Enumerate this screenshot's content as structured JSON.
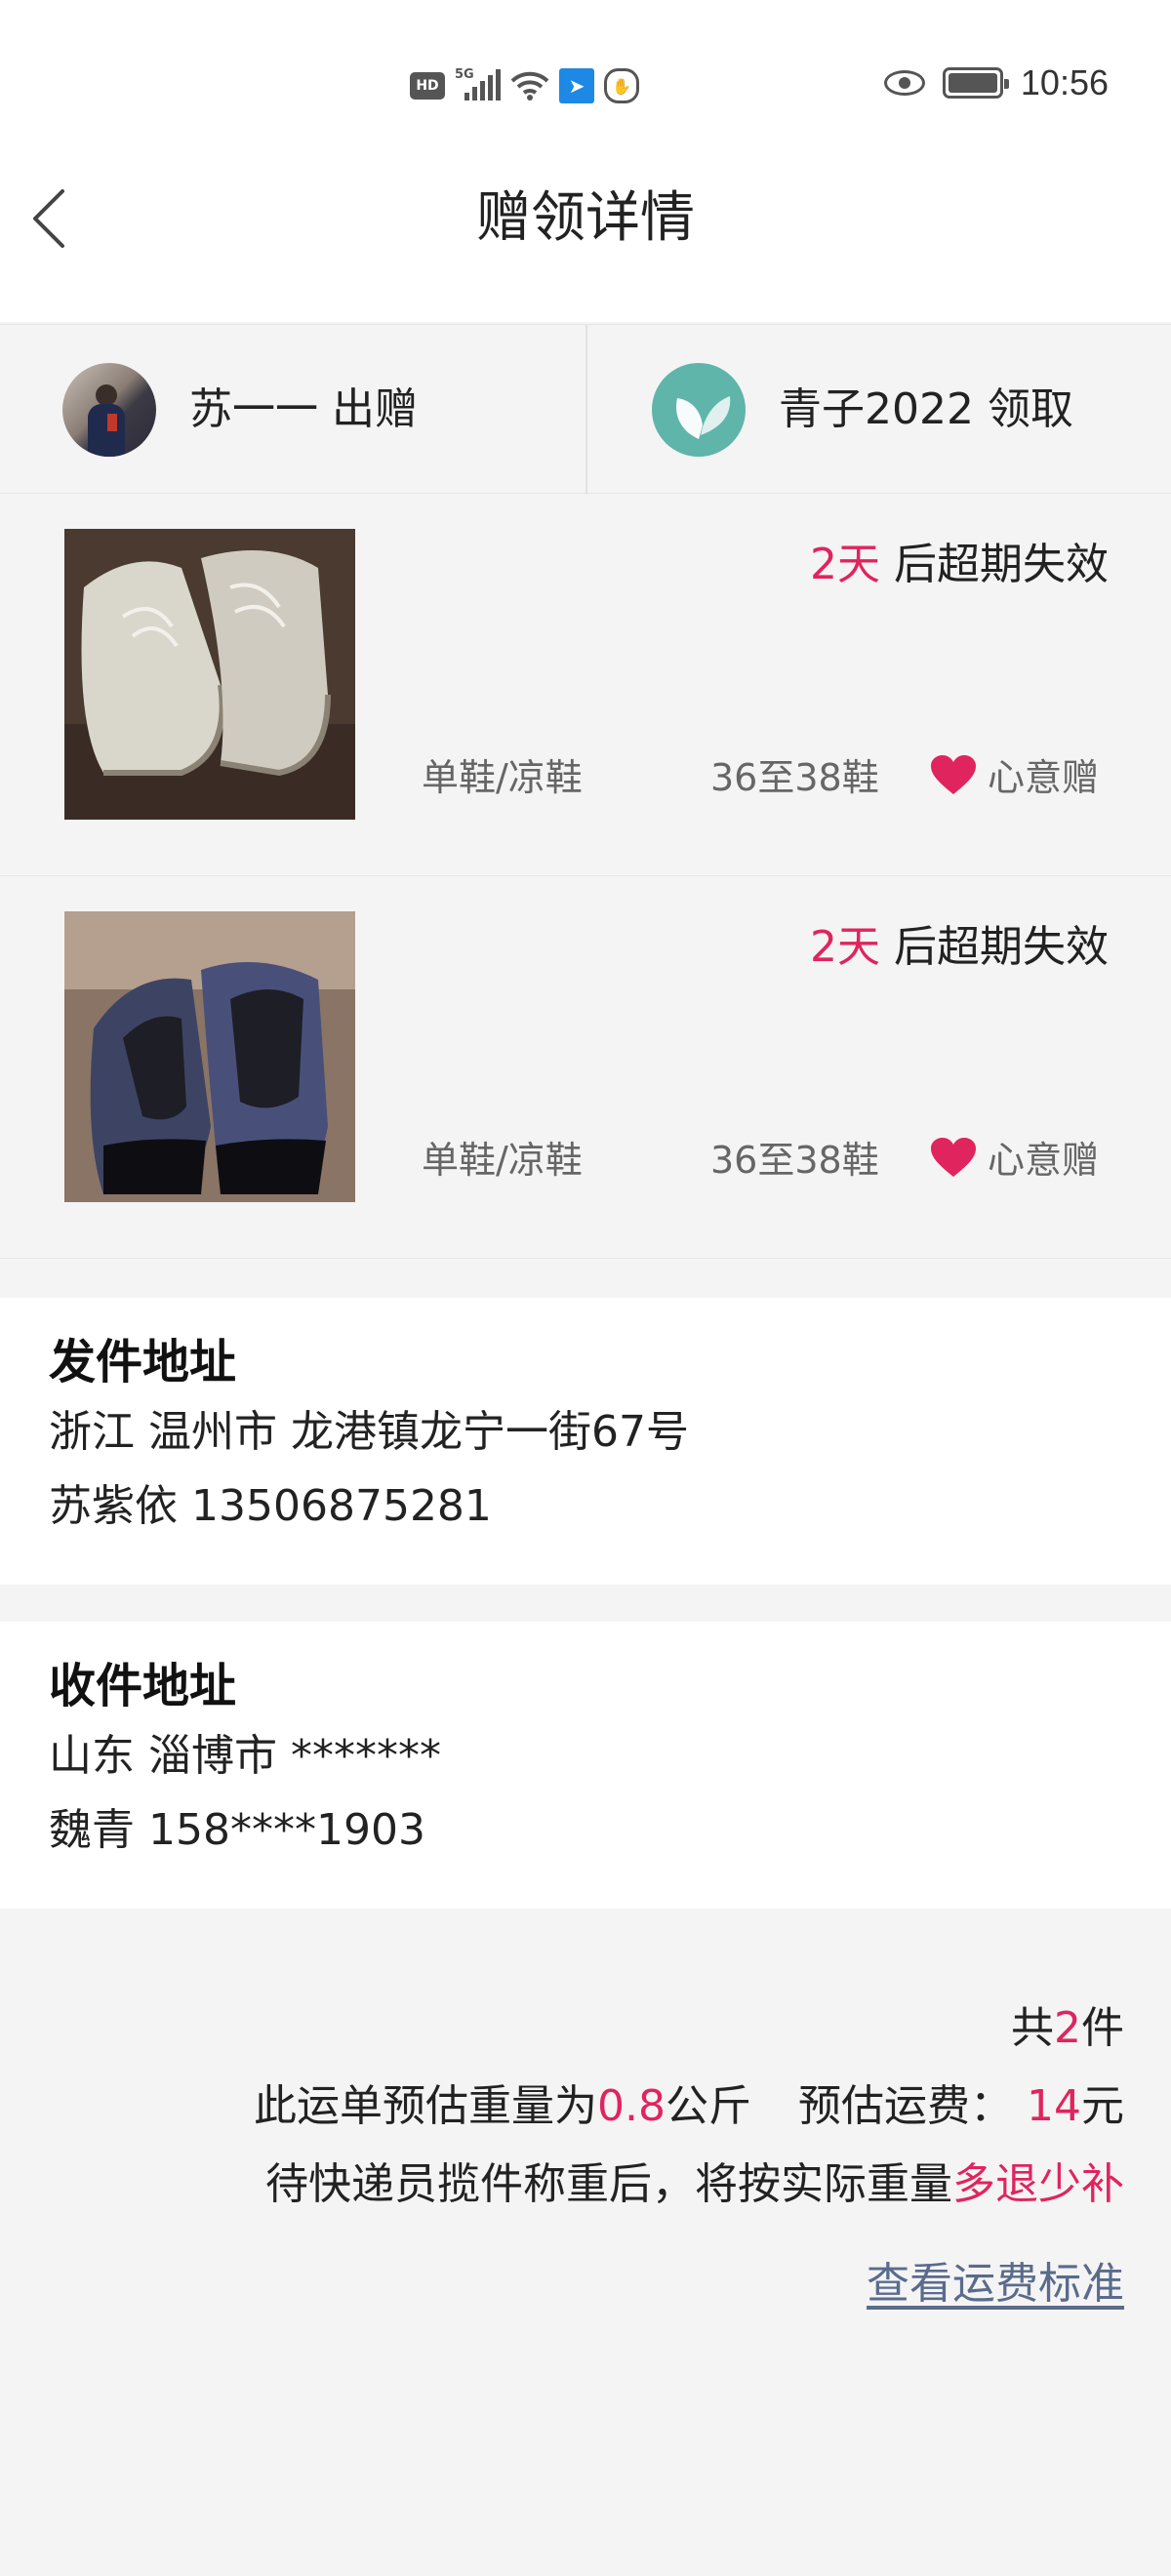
{
  "status_bar": {
    "hd_label": "HD",
    "net_label": "5G",
    "time": "10:56",
    "icons": [
      "hd-icon",
      "signal-icon",
      "wifi-icon",
      "app-notification-icon",
      "hand-icon",
      "eye-icon",
      "battery-icon"
    ]
  },
  "header": {
    "title": "赠领详情",
    "back_icon": "chevron-left-icon"
  },
  "parties": {
    "giver": {
      "name": "苏一一",
      "role": "出赠"
    },
    "receiver": {
      "name": "青子2022",
      "role": "领取"
    }
  },
  "items": [
    {
      "photo": "beige-lace-up-shoes",
      "expire_days": "2天",
      "expire_text": "后超期失效",
      "category": "单鞋/凉鞋",
      "size": "36至38鞋",
      "gift_type": "心意赠"
    },
    {
      "photo": "navy-black-pointed-flats",
      "expire_days": "2天",
      "expire_text": "后超期失效",
      "category": "单鞋/凉鞋",
      "size": "36至38鞋",
      "gift_type": "心意赠"
    }
  ],
  "sender_address": {
    "title": "发件地址",
    "line1": "浙江 温州市 龙港镇龙宁一街67号",
    "line2": "苏紫依 13506875281"
  },
  "receiver_address": {
    "title": "收件地址",
    "line1": "山东 淄博市 *******",
    "line2": "魏青 158****1903"
  },
  "summary": {
    "count_prefix": "共",
    "count": "2",
    "count_suffix": "件",
    "weight_prefix": "此运单预估重量为",
    "weight": "0.8",
    "weight_unit": "公斤",
    "fee_label": "预估运费：",
    "fee": "14",
    "fee_unit": "元",
    "note_prefix": "待快递员揽件称重后，将按实际重量",
    "note_emphasis": "多退少补",
    "fee_standard_link": "查看运费标准"
  },
  "colors": {
    "accent": "#e0245e",
    "link": "#5a6b8c",
    "app_logo": "#5fb5a9"
  }
}
